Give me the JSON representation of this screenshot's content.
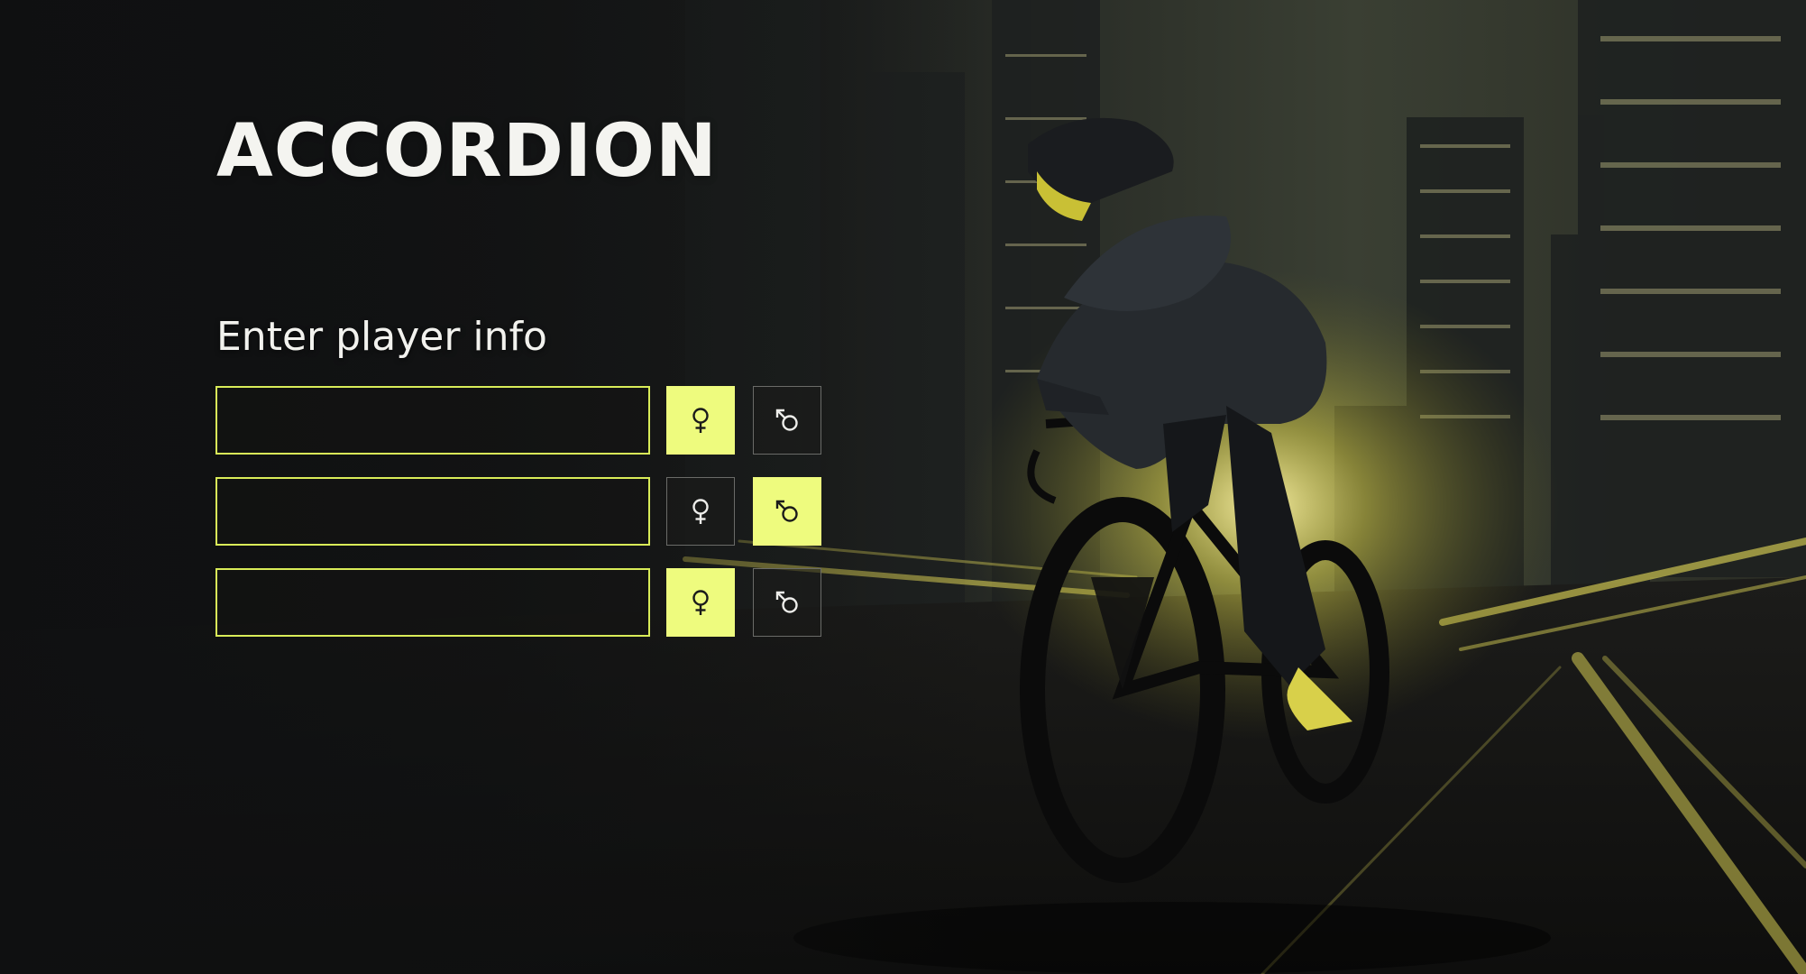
{
  "brand": {
    "logo_text": "ACCORDION"
  },
  "form": {
    "heading": "Enter player info",
    "players": [
      {
        "name": "",
        "gender": "female"
      },
      {
        "name": "",
        "gender": "male"
      },
      {
        "name": "",
        "gender": "female"
      }
    ]
  },
  "icons": {
    "female": "female-symbol-icon",
    "male": "male-symbol-icon"
  },
  "colors": {
    "accent": "#eefb7e",
    "input_border": "#d9ec58",
    "unselected_border": "#6a6b68",
    "background": "#111213"
  },
  "background_image": "Cyclist in aerodynamic helmet riding a time-trial bike through a city street at night, backlit by yellow light with motion-blurred skyscrapers"
}
